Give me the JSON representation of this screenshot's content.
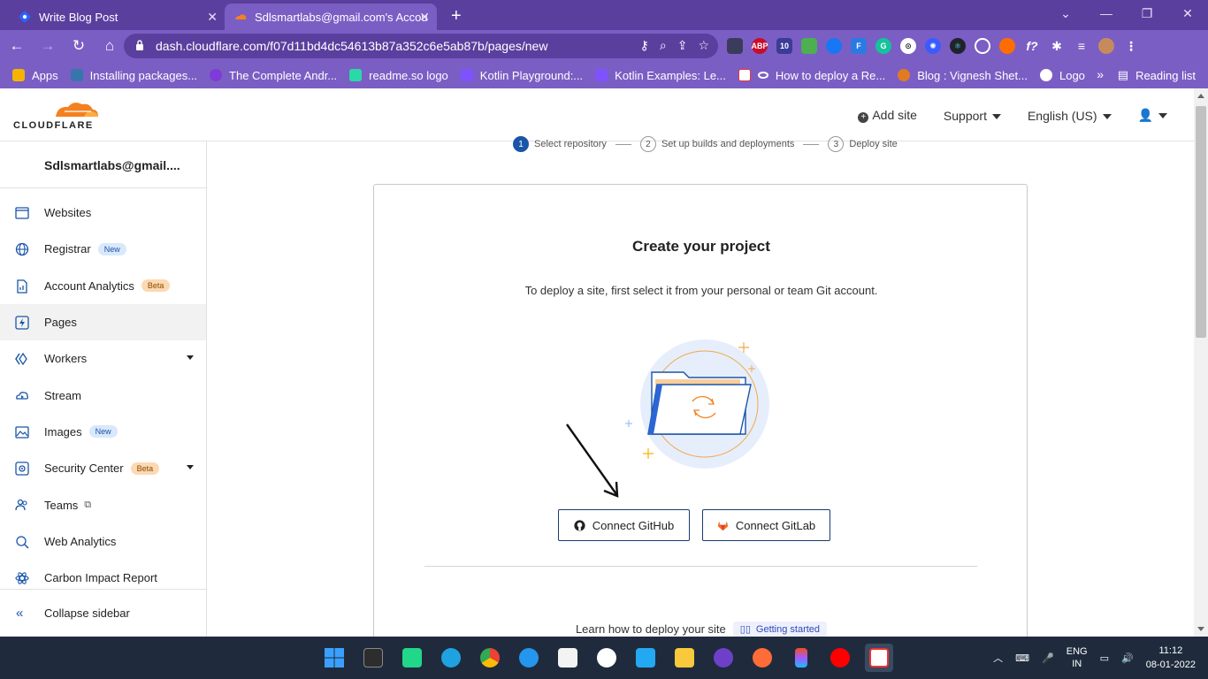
{
  "browser": {
    "tabs": [
      {
        "title": "Write Blog Post"
      },
      {
        "title": "Sdlsmartlabs@gmail.com's Accou"
      }
    ],
    "url": "dash.cloudflare.com/f07d11bd4dc54613b87a352c6e5ab87b/pages/new",
    "extensions": [
      {
        "name": "abp-icon",
        "label": "ABP",
        "color": "#c70d2c"
      },
      {
        "name": "badge-count-icon",
        "label": "10",
        "color": "#3b3b98"
      }
    ],
    "bookmarks": [
      {
        "label": "Apps",
        "color": "#f4b400"
      },
      {
        "label": "Installing packages...",
        "color": "#3776ab"
      },
      {
        "label": "The Complete Andr...",
        "color": "#7e3bd8"
      },
      {
        "label": "readme.so logo",
        "color": "#2bd9a8"
      },
      {
        "label": "Kotlin Playground:...",
        "color": "#7f52ff"
      },
      {
        "label": "Kotlin Examples: Le...",
        "color": "#7f52ff"
      },
      {
        "label": "How to deploy a Re...",
        "color": "#333333"
      },
      {
        "label": "Blog : Vignesh Shet...",
        "color": "#e07b22"
      },
      {
        "label": "Logo",
        "color": "#ffffff"
      }
    ],
    "bookmarks_more": "»",
    "reading_list": "Reading list"
  },
  "header": {
    "logo_text": "CLOUDFLARE",
    "add_site": "Add site",
    "support": "Support",
    "language": "English (US)"
  },
  "sidebar": {
    "account": "Sdlsmartlabs@gmail....",
    "items": [
      {
        "label": "Websites",
        "badge": "",
        "active": false
      },
      {
        "label": "Registrar",
        "badge": "New",
        "active": false
      },
      {
        "label": "Account Analytics",
        "badge": "Beta",
        "active": false
      },
      {
        "label": "Pages",
        "badge": "",
        "active": true
      },
      {
        "label": "Workers",
        "badge": "",
        "active": false
      },
      {
        "label": "Stream",
        "badge": "",
        "active": false
      },
      {
        "label": "Images",
        "badge": "New",
        "active": false
      },
      {
        "label": "Security Center",
        "badge": "Beta",
        "active": false
      },
      {
        "label": "Teams",
        "badge": "",
        "active": false
      },
      {
        "label": "Web Analytics",
        "badge": "",
        "active": false
      },
      {
        "label": "Carbon Impact Report",
        "badge": "",
        "active": false
      }
    ],
    "collapse": "Collapse sidebar"
  },
  "steps": [
    {
      "num": "1",
      "label": "Select repository"
    },
    {
      "num": "2",
      "label": "Set up builds and deployments"
    },
    {
      "num": "3",
      "label": "Deploy site"
    }
  ],
  "main": {
    "title": "Create your project",
    "subtitle": "To deploy a site, first select it from your personal or team Git account.",
    "connect_github": "Connect GitHub",
    "connect_gitlab": "Connect GitLab",
    "learn": "Learn how to deploy your site",
    "getting_started": "Getting started"
  },
  "taskbar": {
    "lang_top": "ENG",
    "lang_bottom": "IN",
    "time": "11:12",
    "date": "08-01-2022"
  },
  "colors": {
    "chrome_dark": "#5b3f9e",
    "chrome_light": "#7b5ec4",
    "accent_blue": "#1a55a8",
    "cloudflare_orange": "#f48120"
  }
}
